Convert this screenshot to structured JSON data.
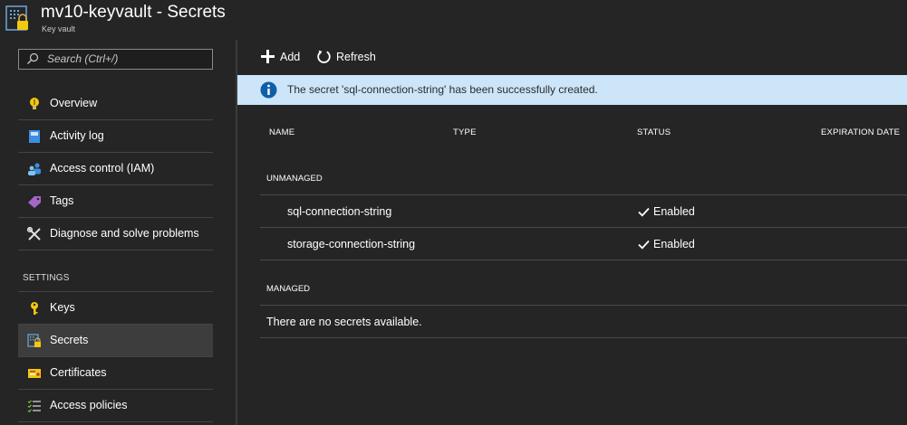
{
  "header": {
    "title": "mv10-keyvault - Secrets",
    "subtitle": "Key vault",
    "icon": "keyvault-lock-icon"
  },
  "sidebar": {
    "search": {
      "placeholder": "Search (Ctrl+/)"
    },
    "items": [
      {
        "label": "Overview",
        "icon": "overview-bulb-icon"
      },
      {
        "label": "Activity log",
        "icon": "activity-log-icon"
      },
      {
        "label": "Access control (IAM)",
        "icon": "people-icon"
      },
      {
        "label": "Tags",
        "icon": "tag-icon"
      },
      {
        "label": "Diagnose and solve problems",
        "icon": "wrench-icon"
      }
    ],
    "settings_label": "SETTINGS",
    "settings_items": [
      {
        "label": "Keys",
        "icon": "key-icon",
        "active": false
      },
      {
        "label": "Secrets",
        "icon": "secrets-icon",
        "active": true
      },
      {
        "label": "Certificates",
        "icon": "certificate-icon",
        "active": false
      },
      {
        "label": "Access policies",
        "icon": "policies-icon",
        "active": false
      }
    ]
  },
  "toolbar": {
    "add_label": "Add",
    "refresh_label": "Refresh"
  },
  "notification": {
    "text": "The secret 'sql-connection-string' has been successfully created.",
    "icon": "info-icon"
  },
  "table": {
    "columns": [
      "NAME",
      "TYPE",
      "STATUS",
      "EXPIRATION DATE"
    ],
    "unmanaged_label": "UNMANAGED",
    "unmanaged_rows": [
      {
        "name": "sql-connection-string",
        "type": "",
        "status": "Enabled",
        "expiration": ""
      },
      {
        "name": "storage-connection-string",
        "type": "",
        "status": "Enabled",
        "expiration": ""
      }
    ],
    "managed_label": "MANAGED",
    "managed_empty_text": "There are no secrets available."
  },
  "colors": {
    "background": "#252526",
    "notification_bg": "#cce5f8",
    "info_blue": "#0f5fa8",
    "key_yellow": "#f2c811"
  }
}
